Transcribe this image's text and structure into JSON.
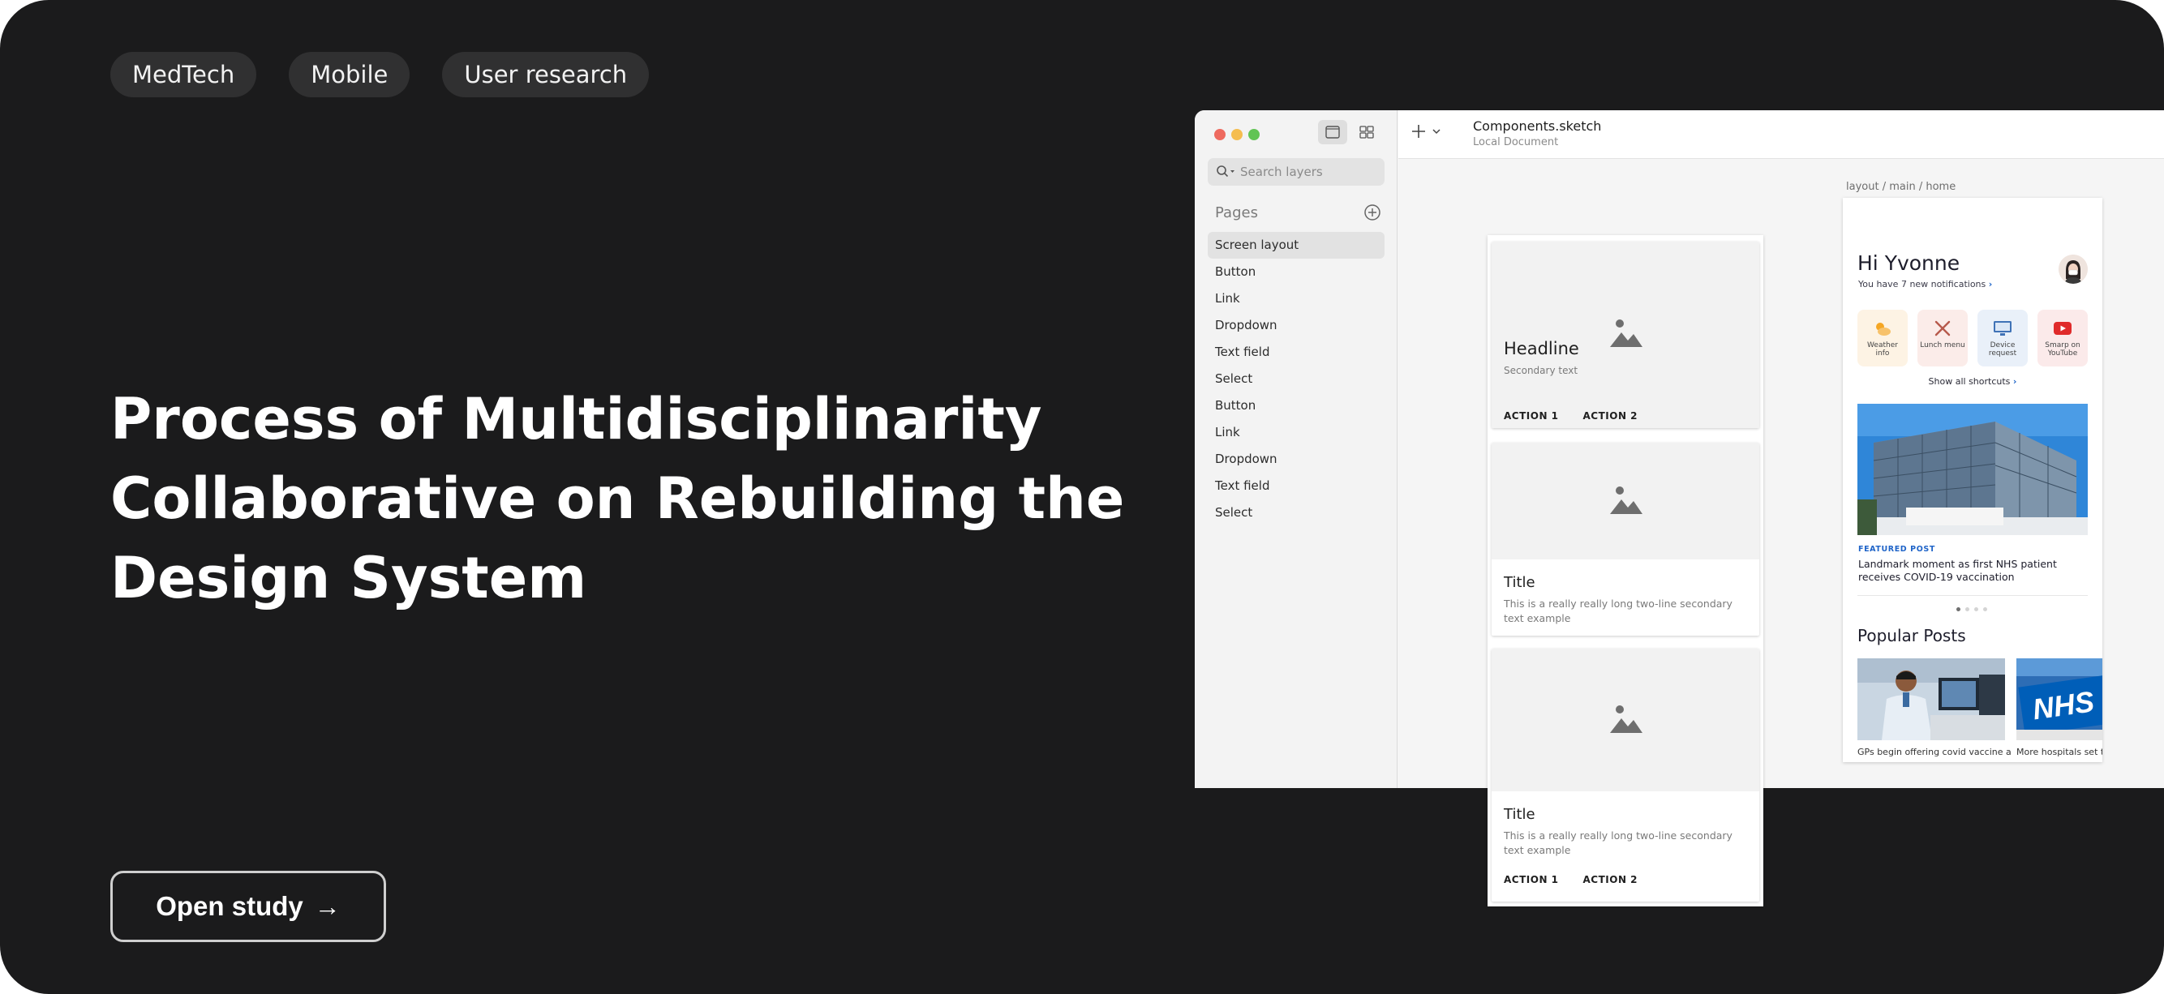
{
  "tags": [
    "MedTech",
    "Mobile",
    "User research"
  ],
  "headline": [
    "Process of Multidisciplinarity",
    "Collaborative on Rebuilding the",
    "Design System"
  ],
  "cta": {
    "label": "Open study",
    "arrow": "→"
  },
  "colors": {
    "background": "#1b1b1c",
    "tag_bg": "#303031",
    "link_blue": "#1f64c8"
  },
  "sketch": {
    "search_placeholder": "Search layers",
    "pages_title": "Pages",
    "pages": [
      "Screen layout",
      "Button",
      "Link",
      "Dropdown",
      "Text field",
      "Select",
      "Button",
      "Link",
      "Dropdown",
      "Text field",
      "Select"
    ],
    "document_name": "Components.sketch",
    "document_location": "Local Document",
    "zoom": "100",
    "artboard_label": "layout / main / home"
  },
  "cards": {
    "headline": "Headline",
    "secondary": "Secondary text",
    "action1": "ACTION 1",
    "action2": "ACTION 2",
    "title": "Title",
    "body": "This is a really really long two-line secondary text example"
  },
  "home": {
    "greeting": "Hi Yvonne",
    "notifications": "You have 7 new notifications",
    "shortcuts": [
      {
        "label": "Weather info",
        "icon": "weather-icon"
      },
      {
        "label": "Lunch menu",
        "icon": "cutlery-icon"
      },
      {
        "label": "Device request",
        "icon": "monitor-icon"
      },
      {
        "label": "Smarp on YouTube",
        "icon": "youtube-icon"
      }
    ],
    "show_all": "Show all shortcuts",
    "featured_label": "FEATURED POST",
    "featured_title": "Landmark moment as first NHS patient receives COVID-19 vaccination",
    "popular_heading": "Popular Posts",
    "popular": [
      "GPs begin offering covid vaccine as",
      "More hospitals set to"
    ],
    "image_text": "NHS"
  }
}
